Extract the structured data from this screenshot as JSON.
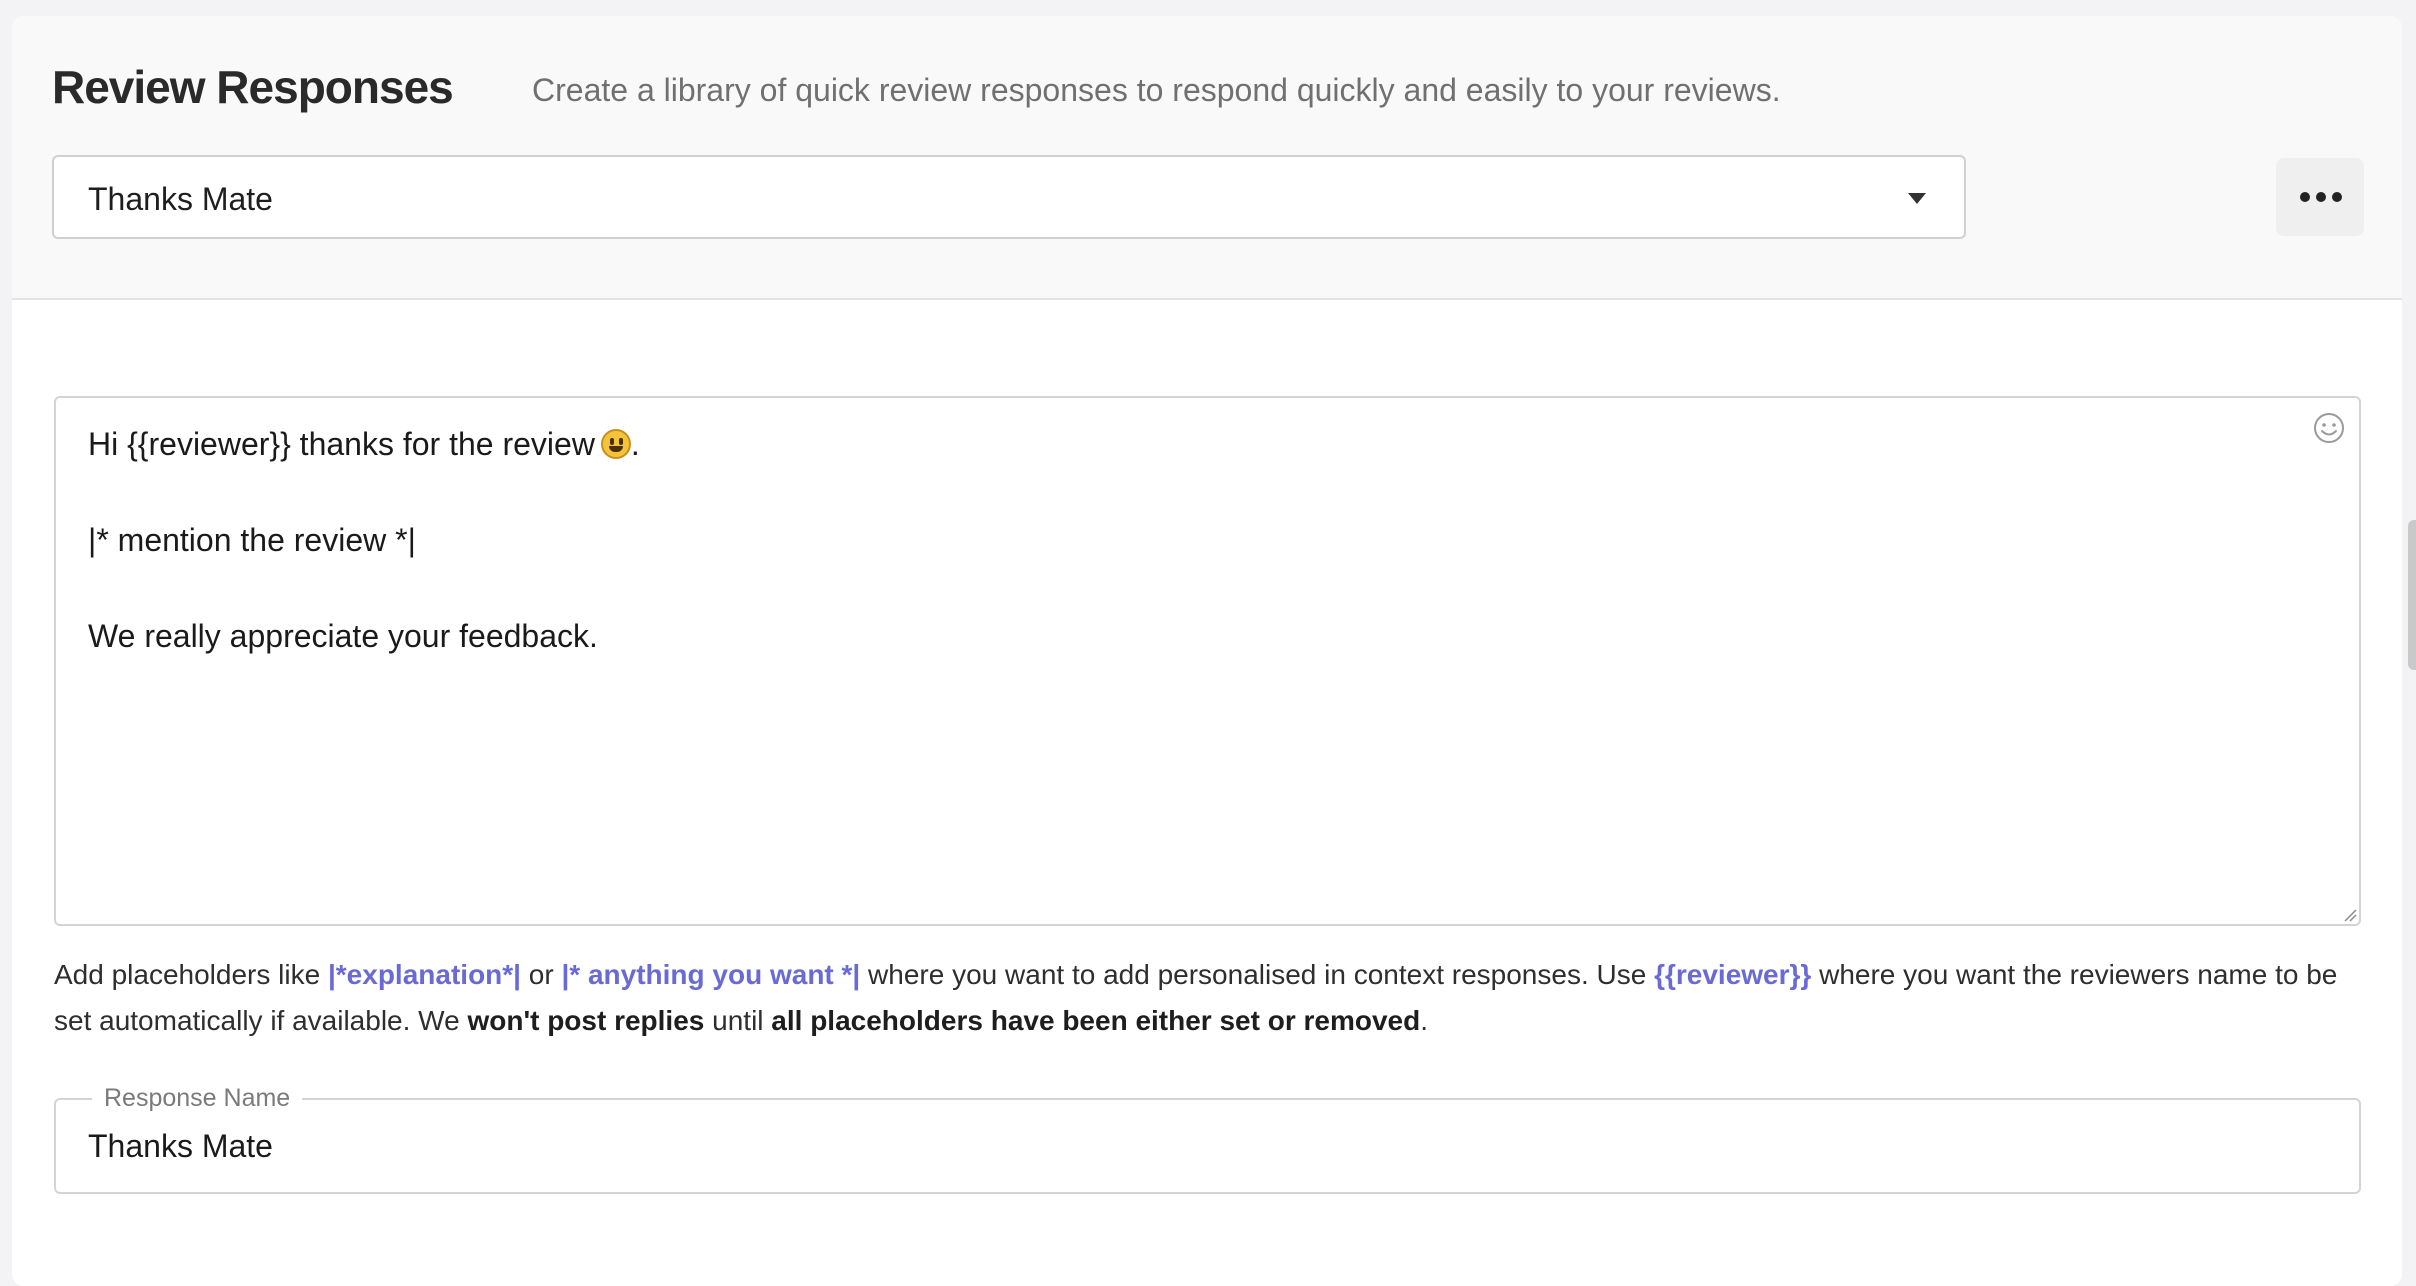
{
  "header": {
    "title": "Review Responses",
    "subtitle": "Create a library of quick review responses to respond quickly and easily to your reviews."
  },
  "response_select": {
    "selected": "Thanks Mate"
  },
  "more_menu": {
    "icon": "more-horizontal-icon"
  },
  "editor": {
    "line1": "Hi {{reviewer}} thanks for the review",
    "line1_end": ".",
    "line2": "|* mention the review *|",
    "line3": "We really appreciate your feedback.",
    "emoji_icon": "smile-icon"
  },
  "help": {
    "t1": "Add placeholders like ",
    "ph1": "|*explanation*|",
    "t2": " or ",
    "ph2": "|* anything you want *|",
    "t3": " where you want to add personalised in context responses. Use ",
    "ph3": "{{reviewer}}",
    "t4": " where you want the reviewers name to be set automatically if available. We ",
    "b1": "won't post replies",
    "t5": " until ",
    "b2": "all placeholders have been either set or removed",
    "t6": "."
  },
  "name_field": {
    "label": "Response Name",
    "value": "Thanks Mate"
  },
  "colors": {
    "placeholder_accent": "#6a6ad6",
    "header_bg": "#f9f9f9",
    "border": "#d4d4d4"
  }
}
